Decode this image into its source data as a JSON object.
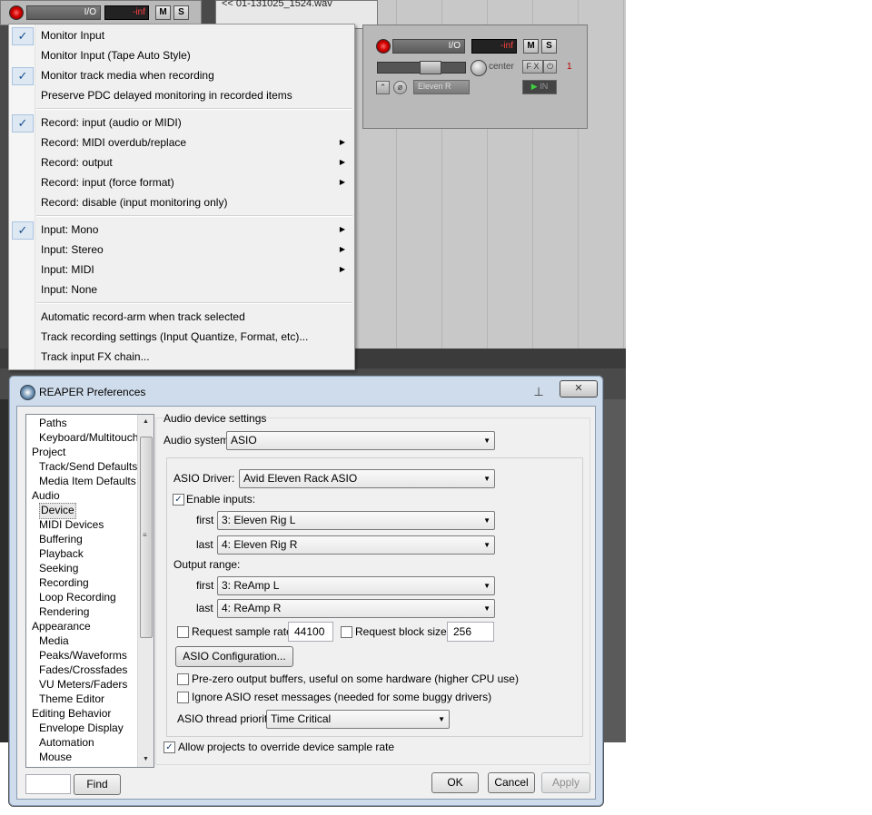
{
  "background": {
    "clip_name": "<< 01-131025_1524.wav",
    "track_top": {
      "io_label": "I/O",
      "vu_label": "-inf",
      "mute": "M",
      "solo": "S"
    },
    "track_main": {
      "io_label": "I/O",
      "vu_label": "-inf",
      "mute": "M",
      "solo": "S",
      "pan_label": "center",
      "fx_label": "F X",
      "power_label": "⏻",
      "track_number": "1",
      "input_label": "Eleven R",
      "in_label": "IN"
    }
  },
  "context_menu": {
    "items": [
      {
        "label": "Monitor Input",
        "checked": "✓",
        "arrow": ""
      },
      {
        "label": "Monitor Input (Tape Auto Style)",
        "checked": "",
        "arrow": ""
      },
      {
        "label": "Monitor track media when recording",
        "checked": "✓",
        "arrow": ""
      },
      {
        "label": "Preserve PDC delayed monitoring in recorded items",
        "checked": "",
        "arrow": ""
      },
      {
        "label": "Record: input (audio or MIDI)",
        "checked": "✓",
        "arrow": ""
      },
      {
        "label": "Record: MIDI overdub/replace",
        "checked": "",
        "arrow": "▶"
      },
      {
        "label": "Record: output",
        "checked": "",
        "arrow": "▶"
      },
      {
        "label": "Record: input (force format)",
        "checked": "",
        "arrow": "▶"
      },
      {
        "label": "Record: disable (input monitoring only)",
        "checked": "",
        "arrow": ""
      },
      {
        "label": "Input: Mono",
        "checked": "✓",
        "arrow": "▶"
      },
      {
        "label": "Input: Stereo",
        "checked": "",
        "arrow": "▶"
      },
      {
        "label": "Input: MIDI",
        "checked": "",
        "arrow": "▶"
      },
      {
        "label": "Input: None",
        "checked": "",
        "arrow": ""
      },
      {
        "label": "Automatic record-arm when track selected",
        "checked": "",
        "arrow": ""
      },
      {
        "label": "Track recording settings (Input Quantize, Format, etc)...",
        "checked": "",
        "arrow": ""
      },
      {
        "label": "Track input FX chain...",
        "checked": "",
        "arrow": ""
      }
    ]
  },
  "preferences": {
    "title": "REAPER Preferences",
    "close_label": "✕",
    "pin_label": "⊥",
    "tree": [
      {
        "label": "Paths",
        "level": 1
      },
      {
        "label": "Keyboard/Multitouch",
        "level": 1
      },
      {
        "label": "Project",
        "level": 0
      },
      {
        "label": "Track/Send Defaults",
        "level": 1
      },
      {
        "label": "Media Item Defaults",
        "level": 1
      },
      {
        "label": "Audio",
        "level": 0
      },
      {
        "label": "Device",
        "level": 1
      },
      {
        "label": "MIDI Devices",
        "level": 1
      },
      {
        "label": "Buffering",
        "level": 1
      },
      {
        "label": "Playback",
        "level": 1
      },
      {
        "label": "Seeking",
        "level": 1
      },
      {
        "label": "Recording",
        "level": 1
      },
      {
        "label": "Loop Recording",
        "level": 1
      },
      {
        "label": "Rendering",
        "level": 1
      },
      {
        "label": "Appearance",
        "level": 0
      },
      {
        "label": "Media",
        "level": 1
      },
      {
        "label": "Peaks/Waveforms",
        "level": 1
      },
      {
        "label": "Fades/Crossfades",
        "level": 1
      },
      {
        "label": "VU Meters/Faders",
        "level": 1
      },
      {
        "label": "Theme Editor",
        "level": 1
      },
      {
        "label": "Editing Behavior",
        "level": 0
      },
      {
        "label": "Envelope Display",
        "level": 1
      },
      {
        "label": "Automation",
        "level": 1
      },
      {
        "label": "Mouse",
        "level": 1
      }
    ],
    "selected_tree_item": "Device",
    "search_value": "",
    "find_label": "Find",
    "section_title": "Audio device settings",
    "audio_system_label": "Audio system:",
    "audio_system_value": "ASIO",
    "asio_driver_label": "ASIO Driver:",
    "asio_driver_value": "Avid Eleven Rack ASIO",
    "enable_inputs_label": "Enable inputs:",
    "enable_inputs_checked": "✓",
    "input_first_label": "first",
    "input_first_value": "3: Eleven Rig L",
    "input_last_label": "last",
    "input_last_value": "4: Eleven Rig R",
    "output_range_label": "Output range:",
    "output_first_label": "first",
    "output_first_value": "3: ReAmp L",
    "output_last_label": "last",
    "output_last_value": "4: ReAmp R",
    "request_sample_rate_label": "Request sample rate:",
    "sample_rate_value": "44100",
    "request_block_size_label": "Request block size:",
    "block_size_value": "256",
    "asio_config_label": "ASIO Configuration...",
    "prezero_label": "Pre-zero output buffers, useful on some hardware (higher CPU use)",
    "ignore_reset_label": "Ignore ASIO reset messages (needed for some buggy drivers)",
    "thread_priority_label": "ASIO thread priority:",
    "thread_priority_value": "Time Critical",
    "allow_override_label": "Allow projects to override device sample rate",
    "allow_override_checked": "✓",
    "ok_label": "OK",
    "cancel_label": "Cancel",
    "apply_label": "Apply"
  }
}
